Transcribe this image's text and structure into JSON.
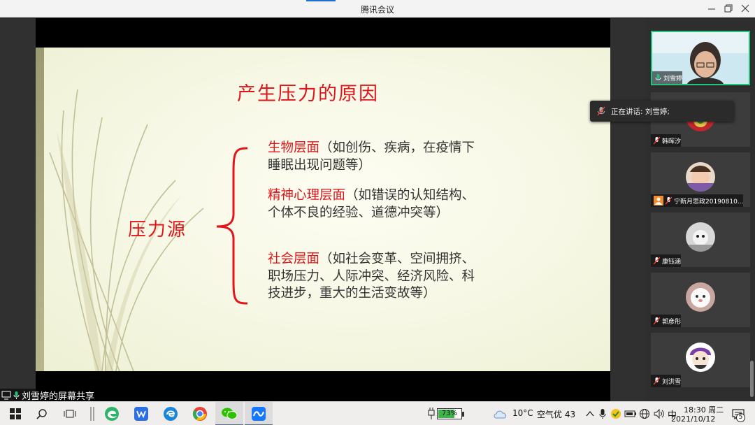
{
  "window": {
    "title": "腾讯会议"
  },
  "slide": {
    "title": "产生压力的原因",
    "source_label": "压力源",
    "items": [
      {
        "highlight": "生物层面",
        "text": "（如创伤、疾病，在疫情下睡眠出现问题等）"
      },
      {
        "highlight": "精神心理层面",
        "text": "（如错误的认知结构、个体不良的经验、道德冲突等）"
      },
      {
        "highlight": "社会层面",
        "text": "（如社会变革、空间拥挤、职场压力、人际冲突、经济风险、科技进步，重大的生活变故等）"
      }
    ]
  },
  "share_label": "刘雪婷的屏幕共享",
  "speaking_tip": "正在讲话: 刘雪婷;",
  "participants": [
    {
      "name": "刘雪婷"
    },
    {
      "name": "韩晖汐"
    },
    {
      "name": "宁新月思政20190810..."
    },
    {
      "name": "康钰涵"
    },
    {
      "name": "郭彦彤"
    },
    {
      "name": "刘洪雪"
    }
  ],
  "taskbar": {
    "battery_text": "73%",
    "battery_level": 0.73,
    "weather_temp": "10°C",
    "weather_air": "空气优 43",
    "ime": "中",
    "time": "18:30 周二",
    "date": "2021/10/12",
    "notifications": "5"
  },
  "colors": {
    "accent_red": "#e0161b",
    "speaking_green": "#25c27a",
    "taskbar_bg": "#f0eded"
  }
}
